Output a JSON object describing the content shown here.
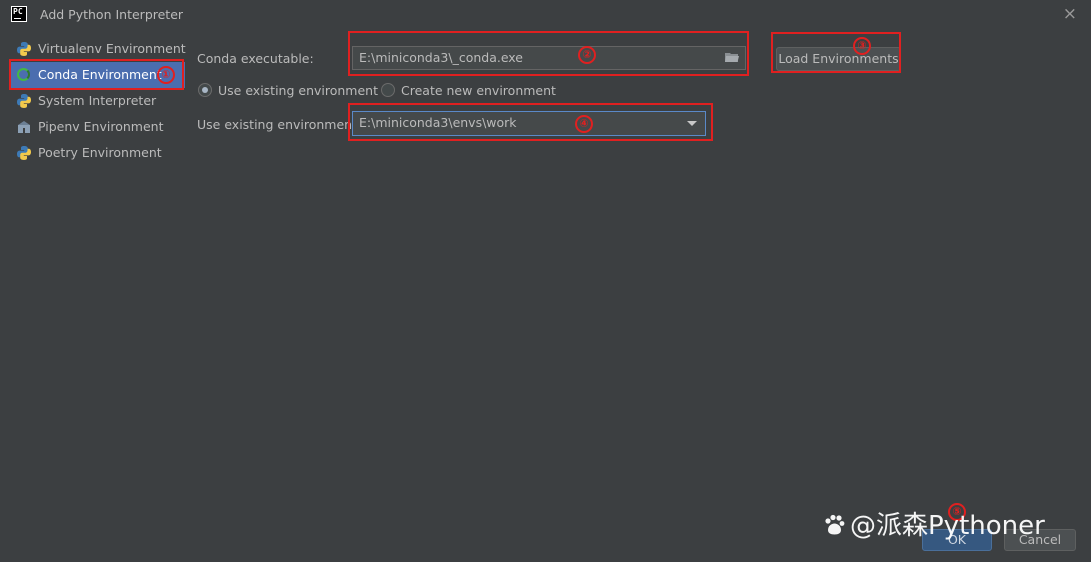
{
  "window": {
    "title": "Add Python Interpreter",
    "app_logo": "PC",
    "close_icon": "×"
  },
  "sidebar": {
    "items": [
      {
        "label": "Virtualenv Environment",
        "icon": "python-icon",
        "selected": false
      },
      {
        "label": "Conda Environment",
        "icon": "conda-icon",
        "selected": true
      },
      {
        "label": "System Interpreter",
        "icon": "python-icon",
        "selected": false
      },
      {
        "label": "Pipenv Environment",
        "icon": "pipenv-icon",
        "selected": false
      },
      {
        "label": "Poetry Environment",
        "icon": "poetry-icon",
        "selected": false
      }
    ]
  },
  "main": {
    "conda_executable_label": "Conda executable:",
    "conda_executable_value": "E:\\miniconda3\\_conda.exe",
    "load_environments_label": "Load Environments",
    "radio_existing_label": "Use existing environment",
    "radio_new_label": "Create new environment",
    "existing_env_label": "Use existing environment:",
    "existing_env_value": "E:\\miniconda3\\envs\\work"
  },
  "footer": {
    "ok_label": "OK",
    "cancel_label": "Cancel"
  },
  "annotations": {
    "marker_1": "①",
    "marker_2": "②",
    "marker_3": "③",
    "marker_4": "④",
    "marker_5": "⑤",
    "color": "#e02020"
  },
  "watermark": {
    "text": "@派森Python​er"
  },
  "colors": {
    "background": "#3c3f41",
    "selection": "#4b6eaf",
    "field_bg": "#45494a",
    "accent_ok": "#365880"
  }
}
